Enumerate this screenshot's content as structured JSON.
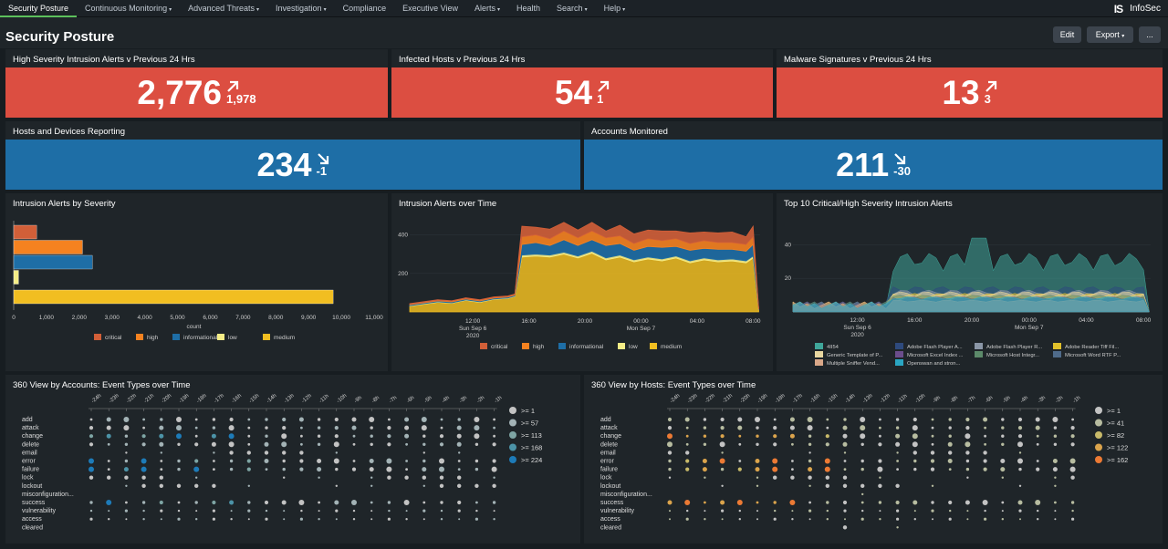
{
  "nav": {
    "items": [
      {
        "label": "Security Posture",
        "dropdown": false,
        "active": true
      },
      {
        "label": "Continuous Monitoring",
        "dropdown": true
      },
      {
        "label": "Advanced Threats",
        "dropdown": true
      },
      {
        "label": "Investigation",
        "dropdown": true
      },
      {
        "label": "Compliance",
        "dropdown": false
      },
      {
        "label": "Executive View",
        "dropdown": false
      },
      {
        "label": "Alerts",
        "dropdown": true
      },
      {
        "label": "Health",
        "dropdown": false
      },
      {
        "label": "Search",
        "dropdown": true
      },
      {
        "label": "Help",
        "dropdown": true
      }
    ],
    "caret": "▾",
    "brand_logo": "IS",
    "brand_name": "InfoSec"
  },
  "page": {
    "title": "Security Posture",
    "edit_label": "Edit",
    "export_label": "Export",
    "export_caret": "▾",
    "more_label": "..."
  },
  "single_values": [
    {
      "title": "High Severity Intrusion Alerts v Previous 24 Hrs",
      "value": "2,776",
      "delta": "1,978",
      "direction": "up",
      "color": "#dc4e41"
    },
    {
      "title": "Infected Hosts v Previous 24 Hrs",
      "value": "54",
      "delta": "1",
      "direction": "up",
      "color": "#dc4e41"
    },
    {
      "title": "Malware Signatures v Previous 24 Hrs",
      "value": "13",
      "delta": "3",
      "direction": "up",
      "color": "#dc4e41"
    },
    {
      "title": "Hosts and Devices Reporting",
      "value": "234",
      "delta": "-1",
      "direction": "down",
      "color": "#1e6ea6"
    },
    {
      "title": "Accounts Monitored",
      "value": "211",
      "delta": "-30",
      "direction": "down",
      "color": "#1e6ea6"
    }
  ],
  "severity_colors": {
    "critical": "#d25f38",
    "high": "#f58220",
    "informational": "#1e6ea6",
    "low": "#f5ed86",
    "medium": "#f1be21"
  },
  "chart_data": [
    {
      "type": "bar",
      "orientation": "horizontal",
      "title": "Intrusion Alerts by Severity",
      "xlabel": "count",
      "xlim": [
        0,
        11000
      ],
      "ticks": [
        "0",
        "1,000",
        "2,000",
        "3,000",
        "4,000",
        "5,000",
        "6,000",
        "7,000",
        "8,000",
        "9,000",
        "10,000",
        "11,000"
      ],
      "categories": [
        "critical",
        "high",
        "informational",
        "low",
        "medium"
      ],
      "values": [
        700,
        2100,
        2400,
        150,
        9750
      ],
      "legend": [
        "critical",
        "high",
        "informational",
        "low",
        "medium"
      ]
    },
    {
      "type": "area",
      "stacked": true,
      "title": "Intrusion Alerts over Time",
      "ylim": [
        0,
        450
      ],
      "y_ticks": [
        200,
        400
      ],
      "x_ticks": [
        {
          "h": 4,
          "lines": [
            "12:00",
            "Sun Sep 6",
            "2020"
          ]
        },
        {
          "h": 8,
          "lines": [
            "16:00"
          ]
        },
        {
          "h": 12,
          "lines": [
            "20:00"
          ]
        },
        {
          "h": 16,
          "lines": [
            "00:00",
            "Mon Sep 7"
          ]
        },
        {
          "h": 20,
          "lines": [
            "04:00"
          ]
        },
        {
          "h": 24,
          "lines": [
            "08:00"
          ]
        }
      ],
      "x_range_hours": [
        -0.5,
        24.5
      ],
      "x": [
        -0.5,
        0.5,
        1.5,
        2.5,
        3.5,
        4.5,
        5.5,
        6.5,
        7.0,
        7.5,
        8.5,
        9.5,
        10.5,
        11.5,
        12.5,
        13.5,
        14.5,
        15.5,
        16.5,
        17.5,
        18.5,
        19.5,
        20.5,
        21.5,
        22.5,
        23.5,
        24.0,
        24.4
      ],
      "series": [
        {
          "name": "medium",
          "values": [
            30,
            40,
            50,
            45,
            60,
            50,
            65,
            70,
            80,
            285,
            290,
            285,
            300,
            280,
            305,
            270,
            285,
            260,
            275,
            265,
            280,
            255,
            270,
            260,
            265,
            255,
            280,
            10
          ]
        },
        {
          "name": "low",
          "values": [
            2,
            2,
            2,
            2,
            2,
            2,
            2,
            2,
            2,
            10,
            10,
            10,
            10,
            10,
            10,
            10,
            10,
            10,
            10,
            10,
            10,
            10,
            10,
            10,
            10,
            10,
            10,
            1
          ]
        },
        {
          "name": "informational",
          "values": [
            5,
            5,
            5,
            5,
            5,
            5,
            5,
            5,
            5,
            55,
            60,
            50,
            65,
            55,
            60,
            65,
            60,
            50,
            55,
            60,
            50,
            55,
            50,
            55,
            50,
            50,
            60,
            2
          ]
        },
        {
          "name": "high",
          "values": [
            3,
            3,
            3,
            3,
            3,
            3,
            3,
            3,
            3,
            40,
            40,
            35,
            45,
            40,
            45,
            40,
            40,
            35,
            40,
            35,
            40,
            35,
            40,
            35,
            35,
            35,
            40,
            1
          ]
        },
        {
          "name": "critical",
          "values": [
            3,
            3,
            3,
            3,
            3,
            3,
            3,
            3,
            3,
            55,
            40,
            50,
            45,
            40,
            45,
            35,
            55,
            50,
            45,
            50,
            40,
            55,
            45,
            50,
            55,
            40,
            55,
            1
          ]
        }
      ],
      "legend": [
        "critical",
        "high",
        "informational",
        "low",
        "medium"
      ]
    },
    {
      "type": "area",
      "stacked": false,
      "title": "Top 10 Critical/High Severity Intrusion Alerts",
      "ylim": [
        0,
        50
      ],
      "y_ticks": [
        20,
        40
      ],
      "x_ticks": [
        {
          "h": 4,
          "lines": [
            "12:00",
            "Sun Sep 6",
            "2020"
          ]
        },
        {
          "h": 8,
          "lines": [
            "16:00"
          ]
        },
        {
          "h": 12,
          "lines": [
            "20:00"
          ]
        },
        {
          "h": 16,
          "lines": [
            "00:00",
            "Mon Sep 7"
          ]
        },
        {
          "h": 20,
          "lines": [
            "04:00"
          ]
        },
        {
          "h": 24,
          "lines": [
            "08:00"
          ]
        }
      ],
      "x_range_hours": [
        -0.5,
        24.5
      ],
      "legend": [
        {
          "name": "4II54",
          "color": "#3fa69a"
        },
        {
          "name": "Adobe Flash Player A...",
          "color": "#2e4a7d"
        },
        {
          "name": "Adobe Flash Player R...",
          "color": "#8a96a6"
        },
        {
          "name": "Adobe Reader Tiff Fil...",
          "color": "#e0c02b"
        },
        {
          "name": "Generic Template of P...",
          "color": "#e8d7a0"
        },
        {
          "name": "Microsoft Excel Index ...",
          "color": "#6b4d8c"
        },
        {
          "name": "Microsoft Host Integr...",
          "color": "#5c8a6a"
        },
        {
          "name": "Microsoft Word RTF P...",
          "color": "#4f6b8a"
        },
        {
          "name": "Multiple Sniffer Vend...",
          "color": "#d9a788"
        },
        {
          "name": "Openswan and stron...",
          "color": "#2aa5c2"
        }
      ]
    }
  ],
  "punchcards": [
    {
      "title": "360 View by Accounts: Event Types over Time",
      "hours": [
        "-24h",
        "-23h",
        "-22h",
        "-21h",
        "-20h",
        "-19h",
        "-18h",
        "-17h",
        "-16h",
        "-15h",
        "-14h",
        "-13h",
        "-12h",
        "-11h",
        "-10h",
        "-9h",
        "-8h",
        "-7h",
        "-6h",
        "-5h",
        "-4h",
        "-3h",
        "-2h",
        "-1h"
      ],
      "rows": [
        "add",
        "attack",
        "change",
        "delete",
        "email",
        "error",
        "failure",
        "lock",
        "lockout",
        "misconfiguration...",
        "success",
        "vulnerability",
        "access",
        "cleared"
      ],
      "legend": [
        {
          "label": ">= 1",
          "color": "#c3c3c3"
        },
        {
          "label": ">= 57",
          "color": "#a3b3b6"
        },
        {
          "label": ">= 113",
          "color": "#7ea5a4"
        },
        {
          "label": ">= 168",
          "color": "#4c93a7"
        },
        {
          "label": ">= 224",
          "color": "#1d7bb8"
        }
      ]
    },
    {
      "title": "360 View by Hosts: Event Types over Time",
      "hours": [
        "-24h",
        "-23h",
        "-22h",
        "-21h",
        "-20h",
        "-19h",
        "-18h",
        "-17h",
        "-16h",
        "-15h",
        "-14h",
        "-13h",
        "-12h",
        "-11h",
        "-10h",
        "-9h",
        "-8h",
        "-7h",
        "-6h",
        "-5h",
        "-4h",
        "-3h",
        "-2h",
        "-1h"
      ],
      "rows": [
        "add",
        "attack",
        "change",
        "delete",
        "email",
        "error",
        "failure",
        "lock",
        "lockout",
        "misconfiguration...",
        "success",
        "vulnerability",
        "access",
        "cleared"
      ],
      "legend": [
        {
          "label": ">= 1",
          "color": "#c3c3c3"
        },
        {
          "label": ">= 41",
          "color": "#b7bca0"
        },
        {
          "label": ">= 82",
          "color": "#c8ba6a"
        },
        {
          "label": ">= 122",
          "color": "#dba44c"
        },
        {
          "label": ">= 162",
          "color": "#ec7a34"
        }
      ]
    }
  ]
}
